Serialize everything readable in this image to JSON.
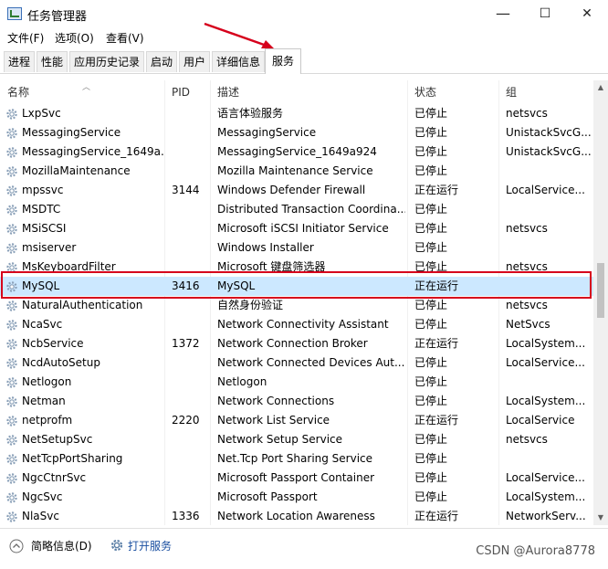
{
  "window": {
    "title": "任务管理器",
    "minimize": "—",
    "maximize": "☐",
    "close": "✕"
  },
  "menu": [
    "文件(F)",
    "选项(O)",
    "查看(V)"
  ],
  "tabs": [
    "进程",
    "性能",
    "应用历史记录",
    "启动",
    "用户",
    "详细信息",
    "服务"
  ],
  "active_tab": "服务",
  "columns": [
    "名称",
    "PID",
    "描述",
    "状态",
    "组"
  ],
  "rows": [
    {
      "name": "LxpSvc",
      "pid": "",
      "desc": "语言体验服务",
      "status": "已停止",
      "group": "netsvcs"
    },
    {
      "name": "MessagingService",
      "pid": "",
      "desc": "MessagingService",
      "status": "已停止",
      "group": "UnistackSvcG..."
    },
    {
      "name": "MessagingService_1649a...",
      "pid": "",
      "desc": "MessagingService_1649a924",
      "status": "已停止",
      "group": "UnistackSvcG..."
    },
    {
      "name": "MozillaMaintenance",
      "pid": "",
      "desc": "Mozilla Maintenance Service",
      "status": "已停止",
      "group": ""
    },
    {
      "name": "mpssvc",
      "pid": "3144",
      "desc": "Windows Defender Firewall",
      "status": "正在运行",
      "group": "LocalService..."
    },
    {
      "name": "MSDTC",
      "pid": "",
      "desc": "Distributed Transaction Coordina...",
      "status": "已停止",
      "group": ""
    },
    {
      "name": "MSiSCSI",
      "pid": "",
      "desc": "Microsoft iSCSI Initiator Service",
      "status": "已停止",
      "group": "netsvcs"
    },
    {
      "name": "msiserver",
      "pid": "",
      "desc": "Windows Installer",
      "status": "已停止",
      "group": ""
    },
    {
      "name": "MsKeyboardFilter",
      "pid": "",
      "desc": "Microsoft 键盘筛选器",
      "status": "已停止",
      "group": "netsvcs"
    },
    {
      "name": "MySQL",
      "pid": "3416",
      "desc": "MySQL",
      "status": "正在运行",
      "group": ""
    },
    {
      "name": "NaturalAuthentication",
      "pid": "",
      "desc": "自然身份验证",
      "status": "已停止",
      "group": "netsvcs"
    },
    {
      "name": "NcaSvc",
      "pid": "",
      "desc": "Network Connectivity Assistant",
      "status": "已停止",
      "group": "NetSvcs"
    },
    {
      "name": "NcbService",
      "pid": "1372",
      "desc": "Network Connection Broker",
      "status": "正在运行",
      "group": "LocalSystem..."
    },
    {
      "name": "NcdAutoSetup",
      "pid": "",
      "desc": "Network Connected Devices Aut...",
      "status": "已停止",
      "group": "LocalService..."
    },
    {
      "name": "Netlogon",
      "pid": "",
      "desc": "Netlogon",
      "status": "已停止",
      "group": ""
    },
    {
      "name": "Netman",
      "pid": "",
      "desc": "Network Connections",
      "status": "已停止",
      "group": "LocalSystem..."
    },
    {
      "name": "netprofm",
      "pid": "2220",
      "desc": "Network List Service",
      "status": "正在运行",
      "group": "LocalService"
    },
    {
      "name": "NetSetupSvc",
      "pid": "",
      "desc": "Network Setup Service",
      "status": "已停止",
      "group": "netsvcs"
    },
    {
      "name": "NetTcpPortSharing",
      "pid": "",
      "desc": "Net.Tcp Port Sharing Service",
      "status": "已停止",
      "group": ""
    },
    {
      "name": "NgcCtnrSvc",
      "pid": "",
      "desc": "Microsoft Passport Container",
      "status": "已停止",
      "group": "LocalService..."
    },
    {
      "name": "NgcSvc",
      "pid": "",
      "desc": "Microsoft Passport",
      "status": "已停止",
      "group": "LocalSystem..."
    },
    {
      "name": "NlaSvc",
      "pid": "1336",
      "desc": "Network Location Awareness",
      "status": "正在运行",
      "group": "NetworkServ..."
    }
  ],
  "selected_row": "MySQL",
  "footer": {
    "brief_info": "简略信息(D)",
    "open_services": "打开服务"
  },
  "watermark": "CSDN @Aurora8778",
  "colors": {
    "selection": "#cce8ff",
    "annotation_red": "#d6001c",
    "link_blue": "#1a4fa0"
  }
}
